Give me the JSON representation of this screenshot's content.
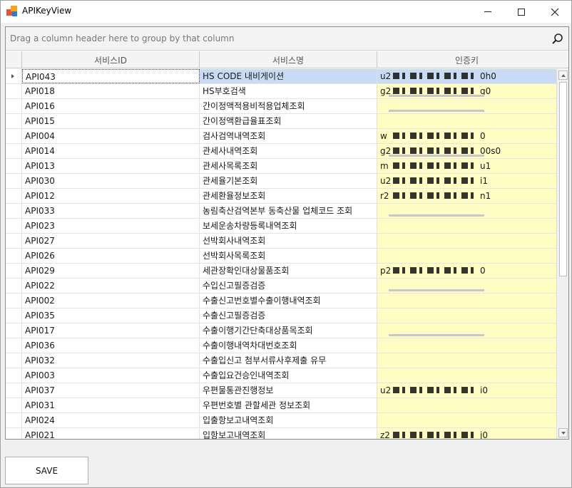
{
  "window": {
    "title": "APIKeyView"
  },
  "group_panel": {
    "text": "Drag a column header here to group by that column"
  },
  "columns": [
    "서비스ID",
    "서비스명",
    "인증키"
  ],
  "rows": [
    {
      "id": "API043",
      "name": "HS CODE 내비게이션",
      "key_prefix": "u2",
      "key_suffix": "0h0",
      "masked": true,
      "bar": false,
      "selected": true
    },
    {
      "id": "API018",
      "name": "HS부호검색",
      "key_prefix": "g2",
      "key_suffix": "g0",
      "masked": true,
      "bar": true,
      "selected": false
    },
    {
      "id": "API016",
      "name": "간이정액적용비적용업체조회",
      "key_prefix": "",
      "key_suffix": "",
      "masked": false,
      "bar": true,
      "selected": false
    },
    {
      "id": "API015",
      "name": "간이정액환급율표조회",
      "key_prefix": "",
      "key_suffix": "",
      "masked": false,
      "bar": false,
      "selected": false
    },
    {
      "id": "API004",
      "name": "검사검역내역조회",
      "key_prefix": "w",
      "key_suffix": "0",
      "masked": true,
      "bar": false,
      "selected": false
    },
    {
      "id": "API014",
      "name": "관세사내역조회",
      "key_prefix": "g2",
      "key_suffix": "00s0",
      "masked": true,
      "bar": true,
      "selected": false
    },
    {
      "id": "API013",
      "name": "관세사목록조회",
      "key_prefix": "m",
      "key_suffix": "u1",
      "masked": true,
      "bar": false,
      "selected": false
    },
    {
      "id": "API030",
      "name": "관세율기본조회",
      "key_prefix": "u2",
      "key_suffix": "i1",
      "masked": true,
      "bar": false,
      "selected": false
    },
    {
      "id": "API012",
      "name": "관세환율정보조회",
      "key_prefix": "r2",
      "key_suffix": "n1",
      "masked": true,
      "bar": false,
      "selected": false
    },
    {
      "id": "API033",
      "name": "농림축산검역본부 동축산물 업체코드 조회",
      "key_prefix": "",
      "key_suffix": "",
      "masked": false,
      "bar": true,
      "selected": false
    },
    {
      "id": "API023",
      "name": "보세운송차량등록내역조회",
      "key_prefix": "",
      "key_suffix": "",
      "masked": false,
      "bar": false,
      "selected": false
    },
    {
      "id": "API027",
      "name": "선박회사내역조회",
      "key_prefix": "",
      "key_suffix": "",
      "masked": false,
      "bar": false,
      "selected": false
    },
    {
      "id": "API026",
      "name": "선박회사목록조회",
      "key_prefix": "",
      "key_suffix": "",
      "masked": false,
      "bar": false,
      "selected": false
    },
    {
      "id": "API029",
      "name": "세관장확인대상물품조회",
      "key_prefix": "p2",
      "key_suffix": "0",
      "masked": true,
      "bar": false,
      "selected": false
    },
    {
      "id": "API022",
      "name": "수입신고필증검증",
      "key_prefix": "",
      "key_suffix": "",
      "masked": false,
      "bar": true,
      "selected": false
    },
    {
      "id": "API002",
      "name": "수출신고번호별수출이행내역조회",
      "key_prefix": "",
      "key_suffix": "",
      "masked": false,
      "bar": false,
      "selected": false
    },
    {
      "id": "API035",
      "name": "수출신고필증검증",
      "key_prefix": "",
      "key_suffix": "",
      "masked": false,
      "bar": false,
      "selected": false
    },
    {
      "id": "API017",
      "name": "수출이행기간단축대상품목조회",
      "key_prefix": "",
      "key_suffix": "",
      "masked": false,
      "bar": true,
      "selected": false
    },
    {
      "id": "API036",
      "name": "수출이행내역차대번호조회",
      "key_prefix": "",
      "key_suffix": "",
      "masked": false,
      "bar": false,
      "selected": false
    },
    {
      "id": "API032",
      "name": "수출입신고 첨부서류사후제출 유무",
      "key_prefix": "",
      "key_suffix": "",
      "masked": false,
      "bar": false,
      "selected": false
    },
    {
      "id": "API003",
      "name": "수출입요건승인내역조회",
      "key_prefix": "",
      "key_suffix": "",
      "masked": false,
      "bar": false,
      "selected": false
    },
    {
      "id": "API037",
      "name": "우편물통관진행정보",
      "key_prefix": "u2",
      "key_suffix": "i0",
      "masked": true,
      "bar": false,
      "selected": false
    },
    {
      "id": "API031",
      "name": "우편번호별 관할세관 정보조회",
      "key_prefix": "",
      "key_suffix": "",
      "masked": false,
      "bar": false,
      "selected": false
    },
    {
      "id": "API024",
      "name": "입출항보고내역조회",
      "key_prefix": "",
      "key_suffix": "",
      "masked": false,
      "bar": false,
      "selected": false
    },
    {
      "id": "API021",
      "name": "입항보고내역조회",
      "key_prefix": "z2",
      "key_suffix": "j0",
      "masked": true,
      "bar": false,
      "selected": false
    }
  ],
  "save_button": {
    "label": "SAVE"
  }
}
